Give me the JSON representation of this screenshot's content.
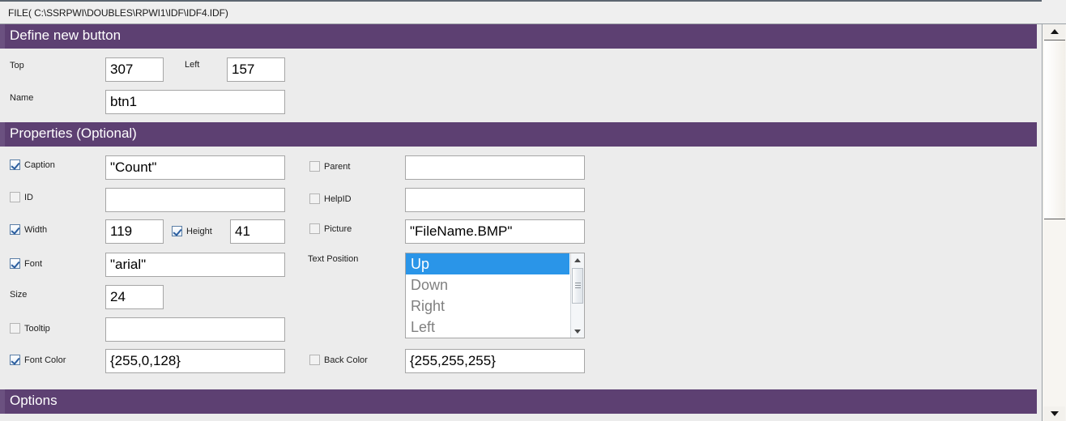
{
  "filebar": {
    "path": "FILE( C:\\SSRPWI\\DOUBLES\\RPWI1\\IDF\\IDF4.IDF)"
  },
  "sections": {
    "define": {
      "title": "Define new button"
    },
    "properties": {
      "title": "Properties (Optional)"
    },
    "options": {
      "title": "Options"
    }
  },
  "define_fields": {
    "top_label": "Top",
    "top_value": "307",
    "left_label": "Left",
    "left_value": "157",
    "name_label": "Name",
    "name_value": "btn1"
  },
  "properties_left": {
    "caption": {
      "label": "Caption",
      "checked": true,
      "value": "\"Count\""
    },
    "id": {
      "label": "ID",
      "checked": false,
      "value": ""
    },
    "width": {
      "label": "Width",
      "checked": true,
      "value": "119"
    },
    "height": {
      "label": "Height",
      "checked": true,
      "value": "41"
    },
    "font": {
      "label": "Font",
      "checked": true,
      "value": "\"arial\""
    },
    "size": {
      "label": "Size",
      "value": "24"
    },
    "tooltip": {
      "label": "Tooltip",
      "checked": false,
      "value": ""
    },
    "font_color": {
      "label": "Font Color",
      "checked": true,
      "value": "{255,0,128}"
    }
  },
  "properties_right": {
    "parent": {
      "label": "Parent",
      "checked": false,
      "value": ""
    },
    "help_id": {
      "label": "HelpID",
      "checked": false,
      "value": ""
    },
    "picture": {
      "label": "Picture",
      "checked": false,
      "value": "\"FileName.BMP\""
    },
    "text_position": {
      "label": "Text Position",
      "options": [
        "Up",
        "Down",
        "Right",
        "Left"
      ],
      "selected": "Up"
    },
    "back_color": {
      "label": "Back Color",
      "checked": false,
      "value": "{255,255,255}"
    }
  },
  "scrollbar": {
    "up_icon": "triangle-up-icon",
    "down_icon": "triangle-down-icon"
  },
  "colors": {
    "header_purple": "#5d4072",
    "header_purple_accent": "#6b5180",
    "panel_bg": "#ececec",
    "selection_blue": "#2a95e8",
    "list_text_gray": "#808080"
  }
}
